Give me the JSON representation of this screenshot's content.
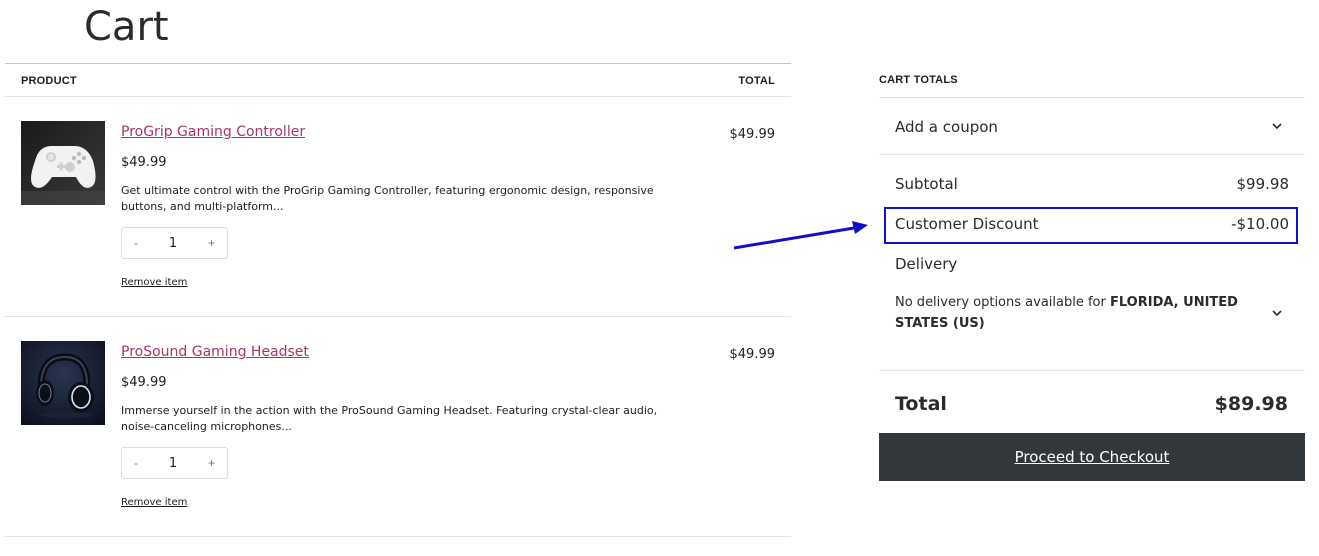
{
  "page": {
    "title": "Cart"
  },
  "table": {
    "header_product": "PRODUCT",
    "header_total": "TOTAL",
    "items": [
      {
        "name": "ProGrip Gaming Controller",
        "price": "$49.99",
        "description": "Get ultimate control with the ProGrip Gaming Controller, featuring ergonomic design, responsive buttons, and multi-platform...",
        "quantity": "1",
        "qty_minus": "-",
        "qty_plus": "+",
        "remove_label": "Remove item",
        "line_total": "$49.99",
        "image_icon": "game-controller-photo"
      },
      {
        "name": "ProSound Gaming Headset",
        "price": "$49.99",
        "description": "Immerse yourself in the action with the ProSound Gaming Headset. Featuring crystal-clear audio, noise-canceling microphones...",
        "quantity": "1",
        "qty_minus": "-",
        "qty_plus": "+",
        "remove_label": "Remove item",
        "line_total": "$49.99",
        "image_icon": "headset-photo"
      }
    ]
  },
  "totals": {
    "heading": "CART TOTALS",
    "coupon_label": "Add a coupon",
    "subtotal_label": "Subtotal",
    "subtotal_value": "$99.98",
    "discount_label": "Customer Discount",
    "discount_value": "-$10.00",
    "delivery_label": "Delivery",
    "delivery_note_prefix": "No delivery options available for ",
    "delivery_note_location": "FLORIDA, UNITED STATES (US)",
    "total_label": "Total",
    "total_value": "$89.98",
    "checkout_label": "Proceed to Checkout"
  },
  "colors": {
    "link": "#a8336d",
    "checkout_bg": "#32373c",
    "highlight": "#1010c8"
  }
}
